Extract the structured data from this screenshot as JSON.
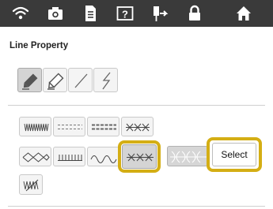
{
  "topbar": {
    "icons": [
      "wifi-icon",
      "camera-icon",
      "document-icon",
      "help-icon",
      "needle-icon",
      "lock-icon",
      "home-icon"
    ]
  },
  "line_property": {
    "title": "Line Property",
    "tools": [
      "pen-solid-icon",
      "pen-outline-icon",
      "straight-line-icon",
      "zigzag-line-icon"
    ],
    "selected_tool_index": 0
  },
  "stitch_types": {
    "row1": [
      "zigzag-stitch-icon",
      "running-stitch-icon",
      "triple-stitch-icon",
      "cross-stitch-icon"
    ],
    "row2": [
      "diamond-stitch-icon",
      "comb-stitch-icon",
      "wave-stitch-icon",
      "cross-chain-stitch-icon",
      "pattern-preview-icon"
    ],
    "row3": [
      "candlewick-stitch-icon"
    ],
    "selected": "cross-chain-stitch-icon",
    "select_label": "Select"
  },
  "colors": {
    "highlight": "#d4ae14",
    "topbar": "#3a3a3a"
  }
}
